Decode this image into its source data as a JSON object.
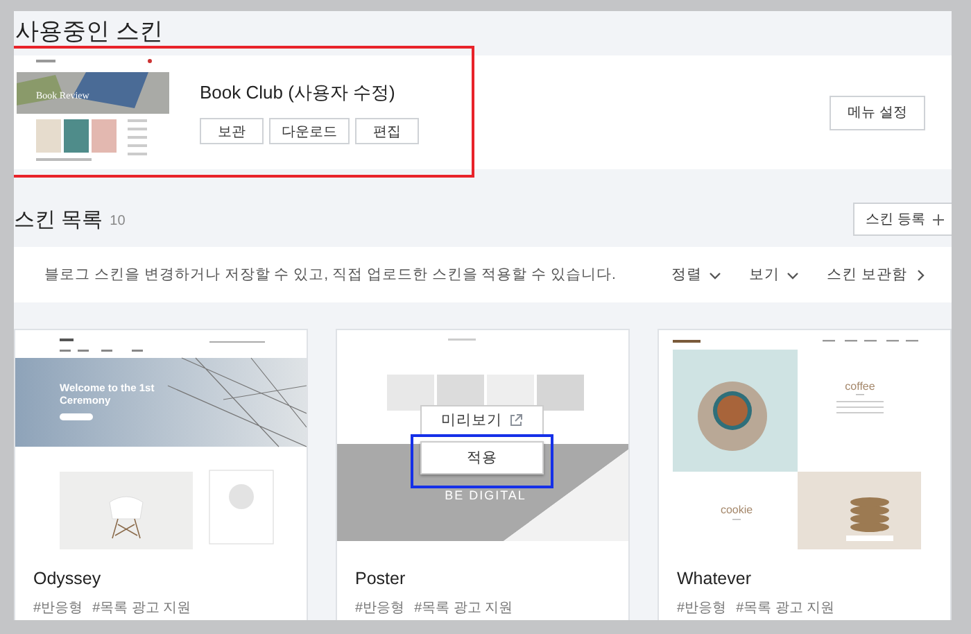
{
  "current_skin": {
    "heading": "사용중인 스킨",
    "preview": {
      "banner": "Book Review"
    },
    "name": "Book Club (사용자 수정)",
    "actions": [
      "보관",
      "다운로드",
      "편집"
    ],
    "menu_button": "메뉴 설정",
    "highlighted": true
  },
  "skin_list": {
    "heading": "스킨 목록",
    "count": "10",
    "register_button": "스킨 등록",
    "description": "블로그 스킨을 변경하거나 저장할 수 있고, 직접 업로드한 스킨을 적용할 수 있습니다.",
    "controls": [
      {
        "label": "정렬",
        "kind": "dropdown"
      },
      {
        "label": "보기",
        "kind": "dropdown"
      },
      {
        "label": "스킨 보관함",
        "kind": "link"
      }
    ],
    "cards": [
      {
        "name": "Odyssey",
        "tags": [
          "#반응형",
          "#목록 광고 지원"
        ],
        "preview": {
          "kind": "odyssey",
          "texts": [
            "Welcome to the 1st",
            "Ceremony"
          ]
        }
      },
      {
        "name": "Poster",
        "tags": [
          "#반응형",
          "#목록 광고 지원"
        ],
        "preview": {
          "kind": "poster",
          "texts": [
            "BE DIGITAL"
          ]
        },
        "overlay": {
          "preview_button": "미리보기",
          "apply_button": "적용",
          "apply_highlighted": true
        }
      },
      {
        "name": "Whatever",
        "tags": [
          "#반응형",
          "#목록 광고 지원"
        ],
        "preview": {
          "kind": "whatever",
          "texts": [
            "coffee",
            "cookie"
          ]
        }
      }
    ]
  }
}
